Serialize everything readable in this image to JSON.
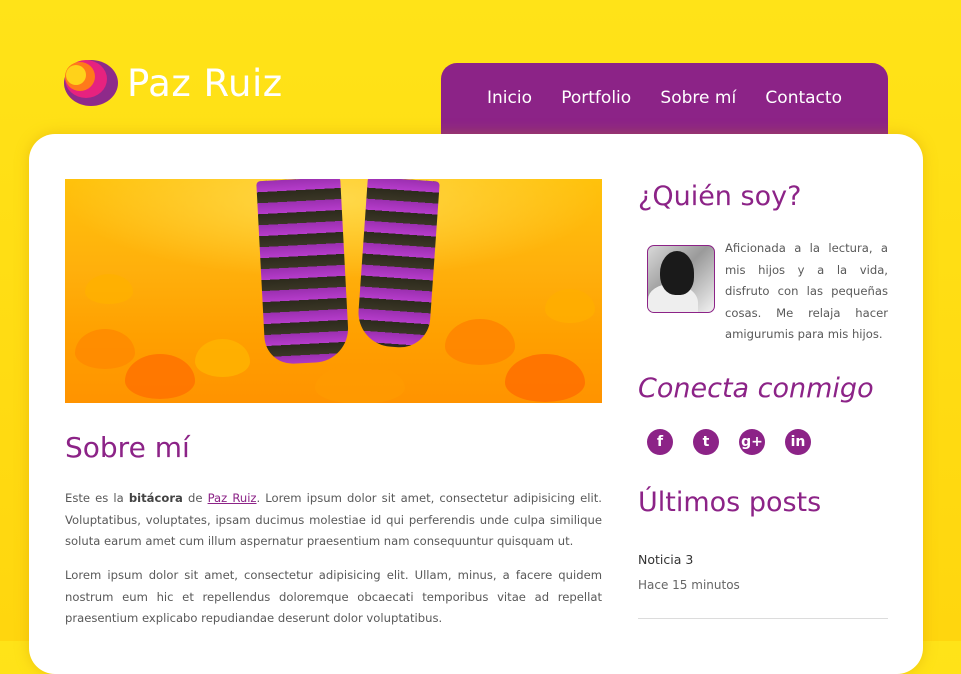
{
  "site": {
    "name": "Paz Ruiz"
  },
  "nav": [
    {
      "label": "Inicio"
    },
    {
      "label": "Portfolio"
    },
    {
      "label": "Sobre mí"
    },
    {
      "label": "Contacto"
    }
  ],
  "main": {
    "title": "Sobre mí",
    "p1_before": "Este es la ",
    "p1_bold": "bitácora",
    "p1_mid": " de ",
    "p1_link": "Paz Ruiz",
    "p1_after": ". Lorem ipsum dolor sit amet, consectetur adipisicing elit. Voluptatibus, voluptates, ipsam ducimus molestiae id qui perferendis unde culpa similique soluta earum amet cum illum aspernatur praesentium nam consequuntur quisquam ut.",
    "p2": "Lorem ipsum dolor sit amet, consectetur adipisicing elit. Ullam, minus, a facere quidem nostrum eum hic et repellendus doloremque obcaecati temporibus vitae ad repellat praesentium explicabo repudiandae deserunt dolor voluptatibus."
  },
  "sidebar": {
    "about_title": "¿Quién soy?",
    "about_text": "Aficionada a la lectura, a mis hijos y a la vida, disfruto con las pequeñas cosas. Me relaja hacer amigurumis para mis hijos.",
    "connect_title": "Conecta conmigo",
    "social": [
      {
        "icon": "facebook-icon",
        "glyph": "f"
      },
      {
        "icon": "twitter-icon",
        "glyph": "t"
      },
      {
        "icon": "google-plus-icon",
        "glyph": "g+"
      },
      {
        "icon": "linkedin-icon",
        "glyph": "in"
      }
    ],
    "posts_title": "Últimos posts",
    "posts": [
      {
        "title": "Noticia 3",
        "time": "Hace 15 minutos"
      }
    ]
  },
  "colors": {
    "accent": "#8c2387",
    "background": "#ffe318"
  }
}
